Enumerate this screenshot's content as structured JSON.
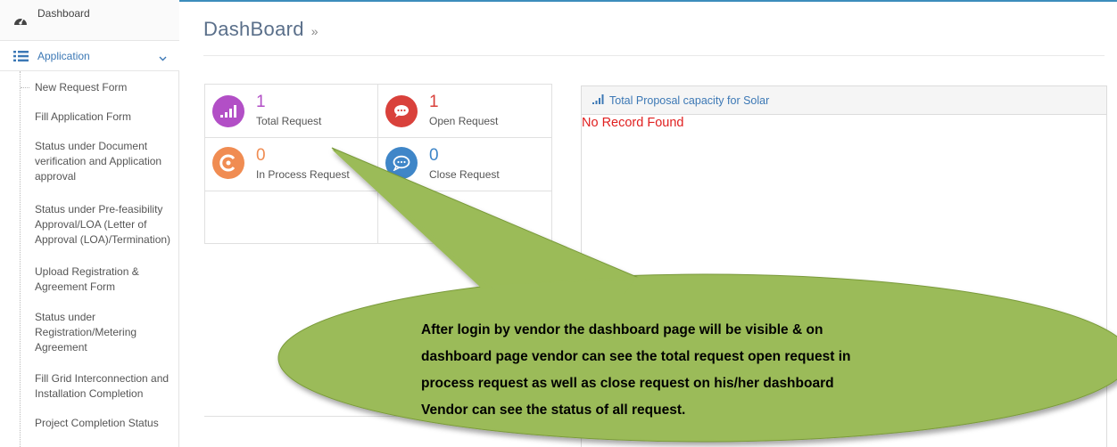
{
  "sidebar": {
    "dashboard_label": "Dashboard",
    "application_label": "Application",
    "items": [
      {
        "label": "New Request Form"
      },
      {
        "label": "Fill Application Form"
      },
      {
        "label": "Status under Document verification and Application approval"
      },
      {
        "label": "Status under Pre-feasibility Approval/LOA (Letter of Approval (LOA)/Termination)"
      },
      {
        "label": "Upload Registration & Agreement Form"
      },
      {
        "label": "Status under Registration/Metering Agreement"
      },
      {
        "label": "Fill Grid Interconnection and Installation Completion"
      },
      {
        "label": "Project Completion Status"
      }
    ]
  },
  "page": {
    "title": "DashBoard",
    "title_suffix": "»"
  },
  "stats": {
    "total": {
      "value": "1",
      "label": "Total Request",
      "color": "#b24fc6"
    },
    "open": {
      "value": "1",
      "label": "Open Request",
      "color": "#d9413b"
    },
    "in_process": {
      "value": "0",
      "label": "In Process Request",
      "color": "#f08c52"
    },
    "close": {
      "value": "0",
      "label": "Close Request",
      "color": "#3f86c8"
    }
  },
  "panel": {
    "title": "Total Proposal capacity for Solar",
    "empty_message": "No Record Found"
  },
  "callout": {
    "lines": [
      "After login by vendor the dashboard page will be visible & on",
      "dashboard page vendor can see the total request open request in",
      "process request as well as close request on his/her dashboard",
      "Vendor can see the status of all request."
    ],
    "fill": "#9bbb59"
  }
}
